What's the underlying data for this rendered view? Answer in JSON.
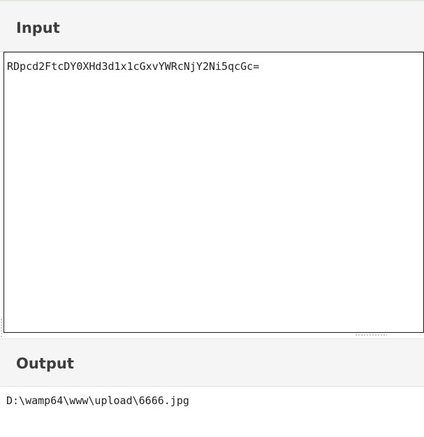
{
  "input": {
    "title": "Input",
    "value": "RDpcd2FtcDY0XHd3d1x1cGxvYWRcNjY2Ni5qcGc="
  },
  "output": {
    "title": "Output",
    "value": "D:\\wamp64\\www\\upload\\6666.jpg"
  }
}
